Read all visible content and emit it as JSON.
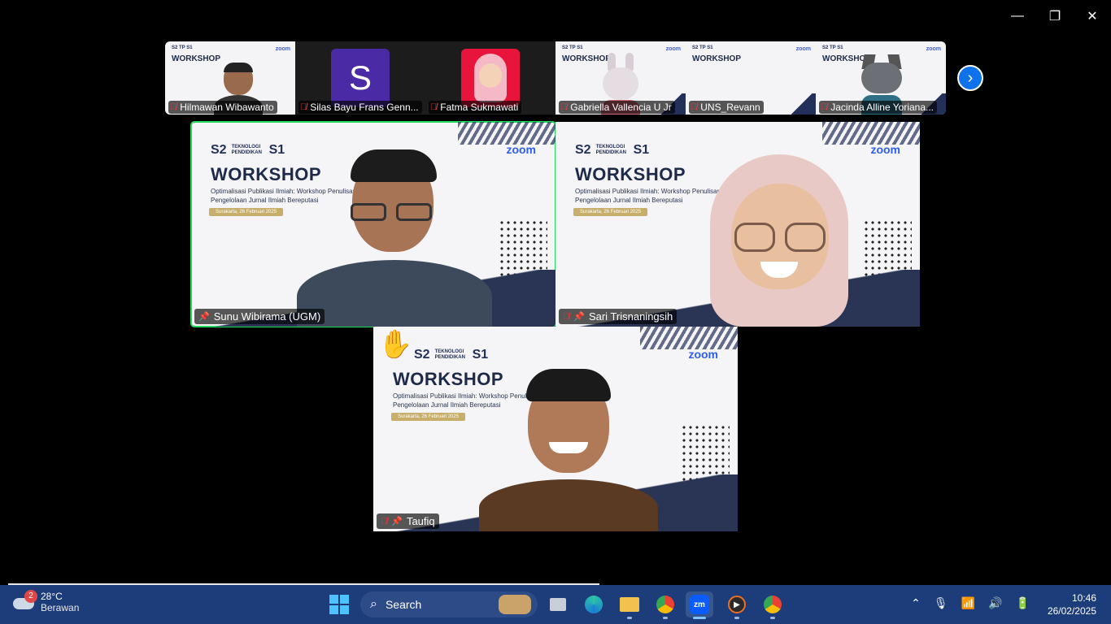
{
  "window": {
    "minimize_glyph": "—",
    "restore_glyph": "❐",
    "close_glyph": "✕"
  },
  "strip": {
    "participants": [
      {
        "name": "Hilmawan Wibawanto",
        "kind": "video-slide",
        "muted": true
      },
      {
        "name": "Silas Bayu Frans Genn...",
        "kind": "avatar",
        "initial": "S",
        "avatar_color": "#4b2aa6",
        "muted": true
      },
      {
        "name": "Fatma Sukmawati",
        "kind": "photo",
        "muted": true
      },
      {
        "name": "Gabriella Vallencia U Jr",
        "kind": "video-slide",
        "muted": true
      },
      {
        "name": "UNS_Revann",
        "kind": "video-slide",
        "muted": true
      },
      {
        "name": "Jacinda Alline Yoriana...",
        "kind": "video-slide",
        "muted": true
      }
    ],
    "slide_title": "WORKSHOP",
    "slide_zoom": "zoom",
    "next_icon": "chevron-right-icon"
  },
  "main": {
    "slide": {
      "s2": "S2",
      "tp": "TEKNOLOGI PENDIDIKAN",
      "s1": "S1",
      "zoom": "zoom",
      "title": "WORKSHOP",
      "subtitle": "Optimalisasi Publikasi Ilmiah: Workshop Penulisan dan Pengelolaan Jurnal Ilmiah Bereputasi",
      "date": "Surakarta, 26 Februari 2025"
    },
    "tiles": [
      {
        "name": "Sunu Wibirama (UGM)",
        "muted": false,
        "pinned": true,
        "active": true
      },
      {
        "name": "Sari Trisnaningsih",
        "muted": true,
        "pinned": true,
        "active": false
      },
      {
        "name": "Taufiq",
        "muted": true,
        "pinned": true,
        "active": false,
        "hand_raised": true
      }
    ]
  },
  "taskbar": {
    "weather_badge": "2",
    "temperature": "28°C",
    "weather_desc": "Berawan",
    "search_label": "Search",
    "time": "10:46",
    "date": "26/02/2025",
    "apps": [
      "file-explorer-icon",
      "edge-icon",
      "folder-icon",
      "chrome-icon",
      "zoom-icon",
      "media-player-icon",
      "chrome-profile-icon"
    ]
  }
}
